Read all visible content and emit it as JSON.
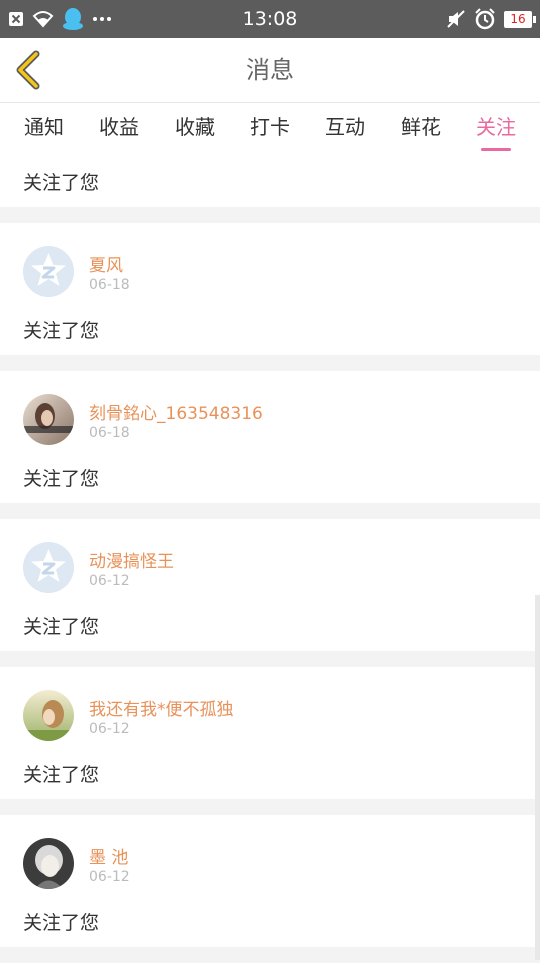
{
  "status_bar": {
    "time": "13:08",
    "battery": "16",
    "left_icons": [
      "close-box-icon",
      "wifi-icon",
      "qq-penguin-icon",
      "more-dots-icon"
    ],
    "right_icons": [
      "mute-icon",
      "alarm-icon",
      "battery-icon"
    ]
  },
  "header": {
    "title": "消息",
    "back_icon": "chevron-left-icon"
  },
  "tabs": [
    {
      "label": "通知"
    },
    {
      "label": "收益"
    },
    {
      "label": "收藏"
    },
    {
      "label": "打卡"
    },
    {
      "label": "互动"
    },
    {
      "label": "鲜花"
    },
    {
      "label": "关注",
      "active": true
    }
  ],
  "colors": {
    "accent": "#e86aa0",
    "username": "#e8925a",
    "date": "#bbbbbb"
  },
  "partial_item": {
    "message": "关注了您"
  },
  "items": [
    {
      "name": "夏风",
      "date": "06-18",
      "message": "关注了您",
      "avatar": "default-qq-avatar"
    },
    {
      "name": "刻骨銘心_163548316",
      "date": "06-18",
      "message": "关注了您",
      "avatar": "photo-avatar"
    },
    {
      "name": "动漫搞怪王",
      "date": "06-12",
      "message": "关注了您",
      "avatar": "default-qq-avatar"
    },
    {
      "name": "我还有我*便不孤独",
      "date": "06-12",
      "message": "关注了您",
      "avatar": "photo-avatar"
    },
    {
      "name": "墨 池",
      "date": "06-12",
      "message": "关注了您",
      "avatar": "anime-avatar"
    }
  ]
}
